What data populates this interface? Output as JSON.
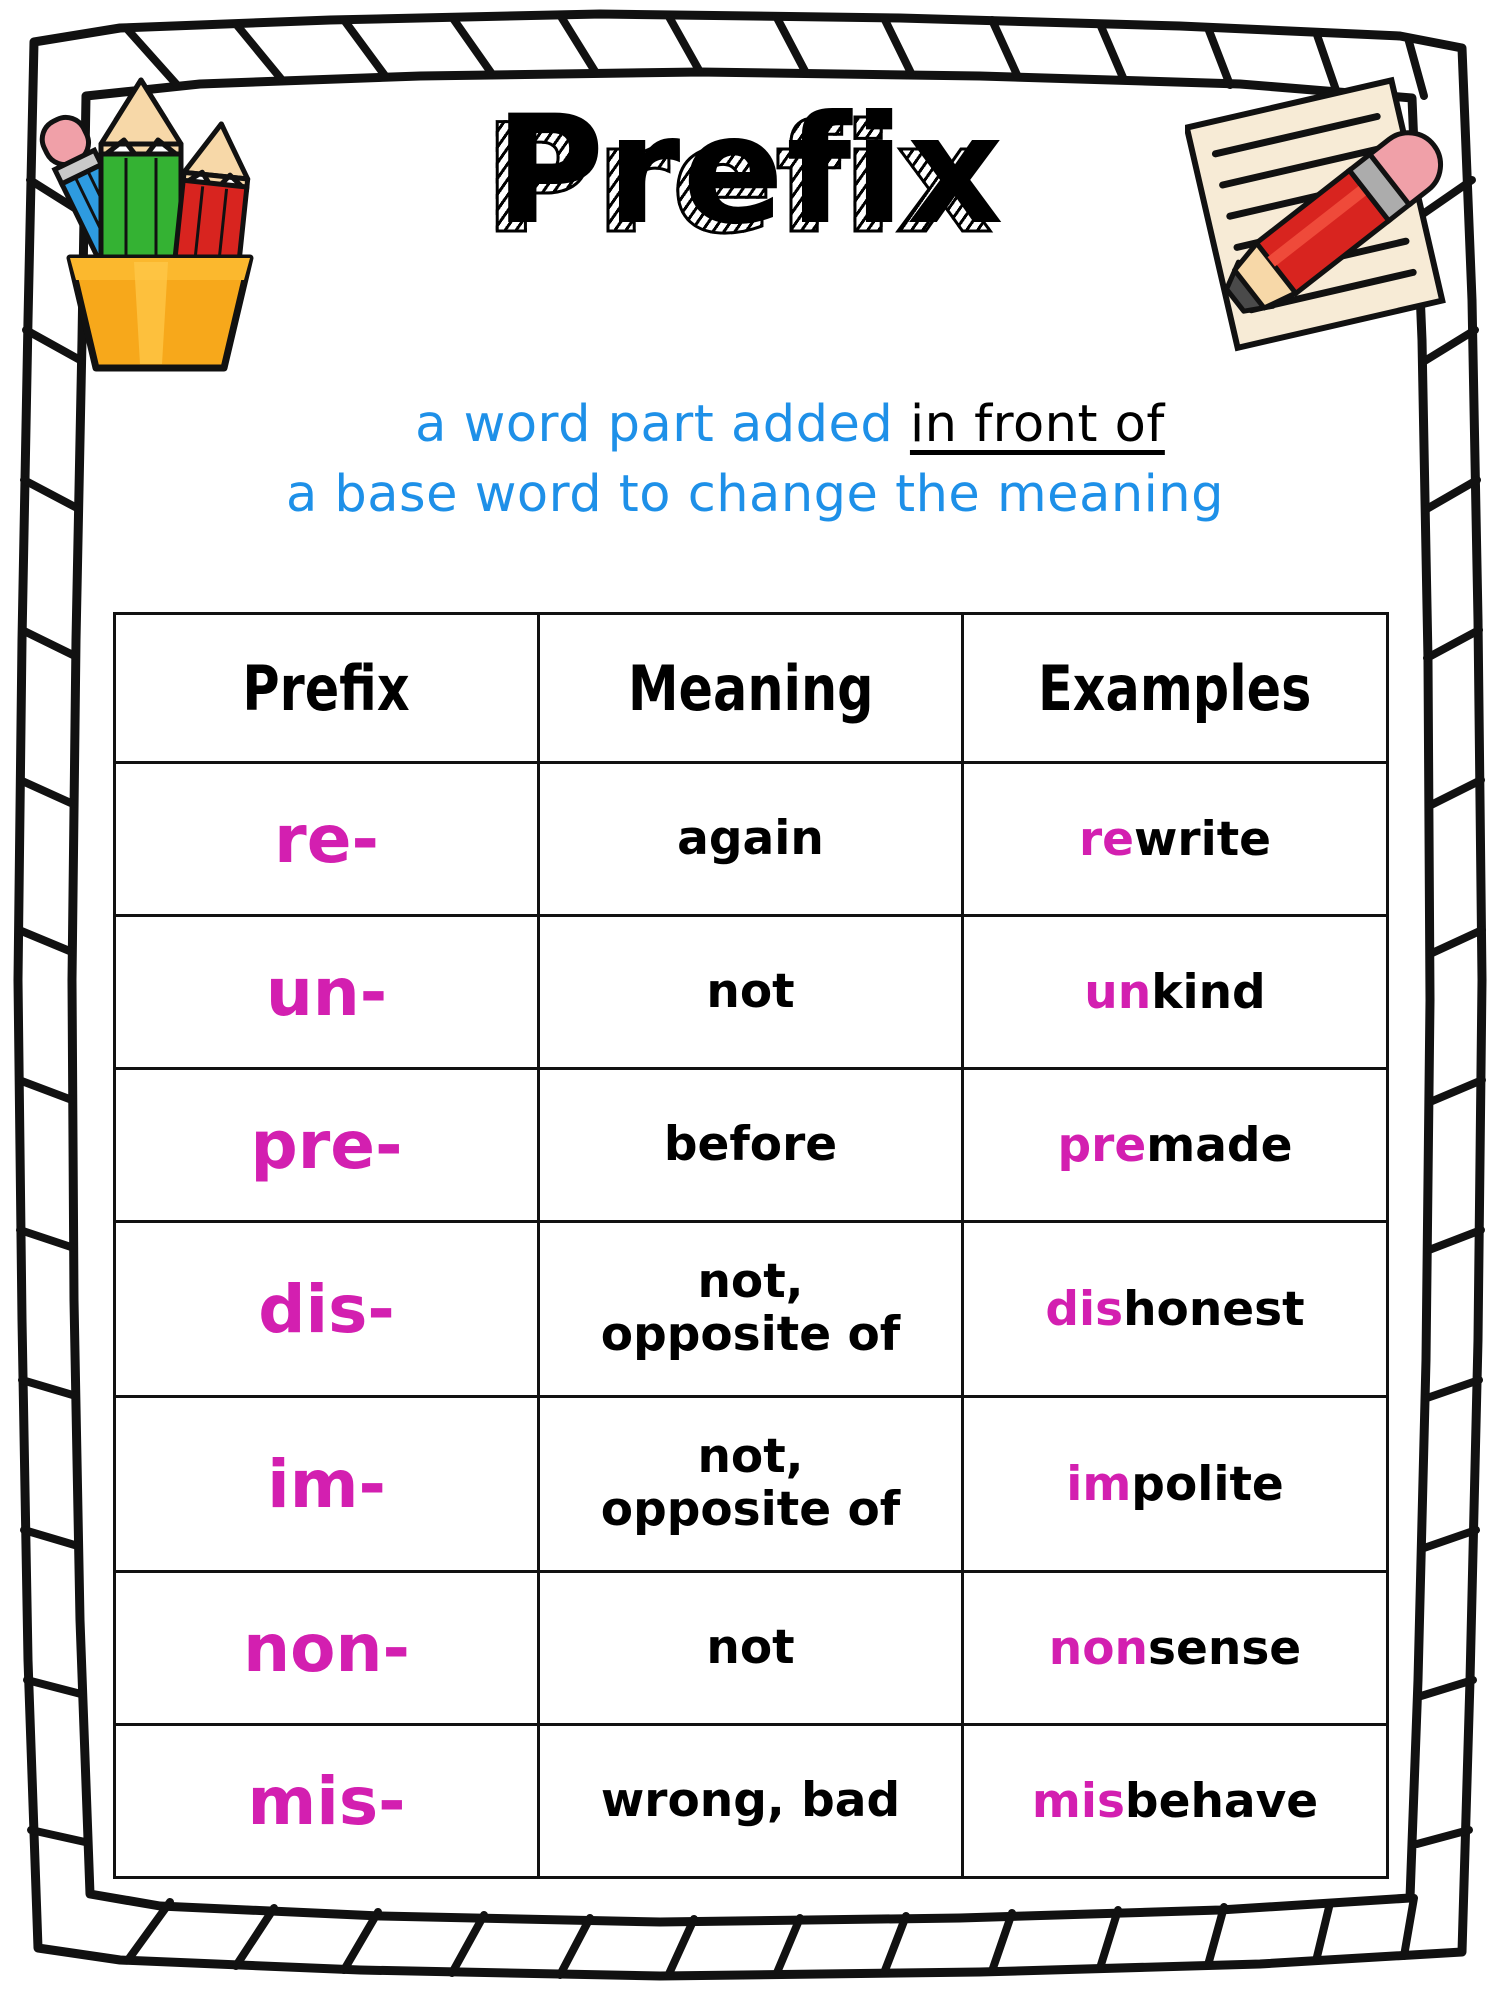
{
  "poster": {
    "title": "Prefix",
    "subtitle": {
      "line1_plain": "a word part added ",
      "line1_emphasis": "in front of",
      "line2": "a base word to change the meaning"
    },
    "colors": {
      "accent_blue": "#1E90E8",
      "accent_magenta": "#D31FB0",
      "ink_black": "#000000",
      "cup_orange": "#F7A81B",
      "paper_cream": "#F7EBD6",
      "pencil_red": "#D8241F",
      "pencil_green": "#34B233",
      "pencil_blue": "#2E9BE0",
      "eraser_pink": "#F0A0A8"
    }
  },
  "table": {
    "headers": [
      "Prefix",
      "Meaning",
      "Examples"
    ],
    "rows": [
      {
        "prefix": "re-",
        "meaning": "again",
        "example_prefix": "re",
        "example_base": "write",
        "tall": false
      },
      {
        "prefix": "un-",
        "meaning": "not",
        "example_prefix": "un",
        "example_base": "kind",
        "tall": false
      },
      {
        "prefix": "pre-",
        "meaning": "before",
        "example_prefix": "pre",
        "example_base": "made",
        "tall": false
      },
      {
        "prefix": "dis-",
        "meaning": "not,\nopposite of",
        "example_prefix": "dis",
        "example_base": "honest",
        "tall": true
      },
      {
        "prefix": "im-",
        "meaning": "not,\nopposite of",
        "example_prefix": "im",
        "example_base": "polite",
        "tall": true
      },
      {
        "prefix": "non-",
        "meaning": "not",
        "example_prefix": "non",
        "example_base": "sense",
        "tall": false
      },
      {
        "prefix": "mis-",
        "meaning": "wrong, bad",
        "example_prefix": "mis",
        "example_base": "behave",
        "tall": false
      }
    ]
  },
  "clipart": {
    "pencil_cup_label": "cup of colored pencils",
    "paper_pencil_label": "lined paper with red pencil"
  }
}
